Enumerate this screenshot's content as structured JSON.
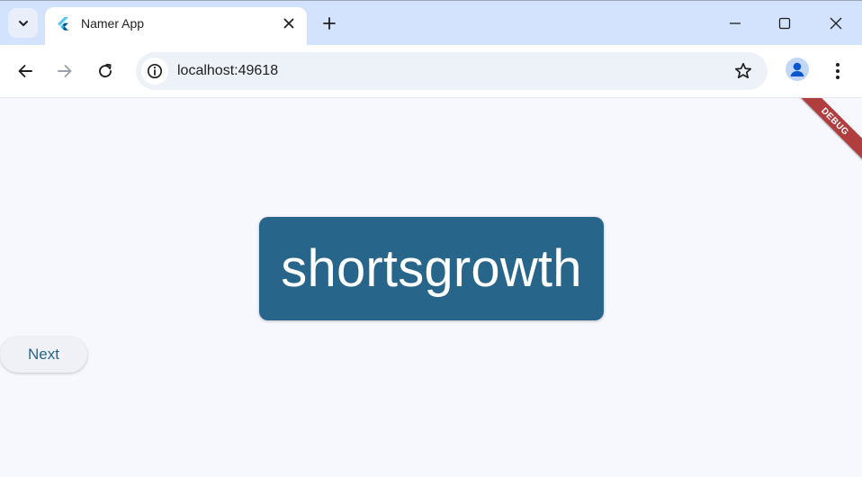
{
  "colors": {
    "tabstrip_bg": "#d3e3fd",
    "toolbar_bg": "#ffffff",
    "omnibox_bg": "#edf1f8",
    "content_bg": "#f7f8fd",
    "card_bg": "#27658b",
    "card_text": "#ffffff",
    "next_text": "#27658b",
    "debug_bg": "#b13e3f"
  },
  "browser": {
    "tab": {
      "title": "Namer App",
      "favicon": "flutter-icon"
    },
    "url": "localhost:49618",
    "icons": {
      "tab_search": "chevron-down-icon",
      "close_tab": "close-icon",
      "new_tab": "plus-icon",
      "minimize": "minimize-icon",
      "maximize": "maximize-icon",
      "close_window": "close-icon",
      "back": "back-arrow-icon",
      "forward": "forward-arrow-icon",
      "reload": "reload-icon",
      "site_info": "info-icon",
      "bookmark": "star-icon",
      "profile": "person-icon",
      "menu": "kebab-menu-icon"
    }
  },
  "app": {
    "word": "shortsgrowth",
    "next_label": "Next",
    "debug_label": "DEBUG"
  }
}
